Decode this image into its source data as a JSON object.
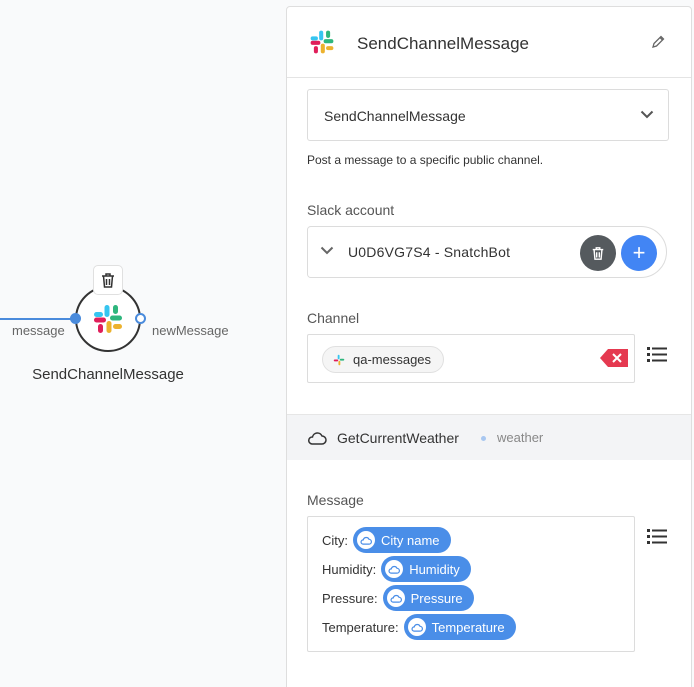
{
  "canvas": {
    "input_port_label": "message",
    "output_port_label": "newMessage",
    "node_title": "SendChannelMessage",
    "node_icon": "slack-icon"
  },
  "panel": {
    "header_title": "SendChannelMessage",
    "method_value": "SendChannelMessage",
    "method_description": "Post a message to a specific public channel.",
    "account_label": "Slack account",
    "account_value": "U0D6VG7S4 -  SnatchBot",
    "add_symbol": "+",
    "channel_label": "Channel",
    "channel_chip": "qa-messages",
    "step": {
      "name": "GetCurrentWeather",
      "sub": "weather"
    },
    "message_label": "Message",
    "message_lines": [
      {
        "label": "City:",
        "var": "City name"
      },
      {
        "label": "Humidity:",
        "var": "Humidity"
      },
      {
        "label": "Pressure:",
        "var": "Pressure"
      },
      {
        "label": "Temperature:",
        "var": "Temperature"
      }
    ]
  },
  "colors": {
    "accent_blue": "#4285f4",
    "chip_blue": "#4a8ee8",
    "clear_red": "#e53950",
    "dark_button": "#555a5e"
  }
}
